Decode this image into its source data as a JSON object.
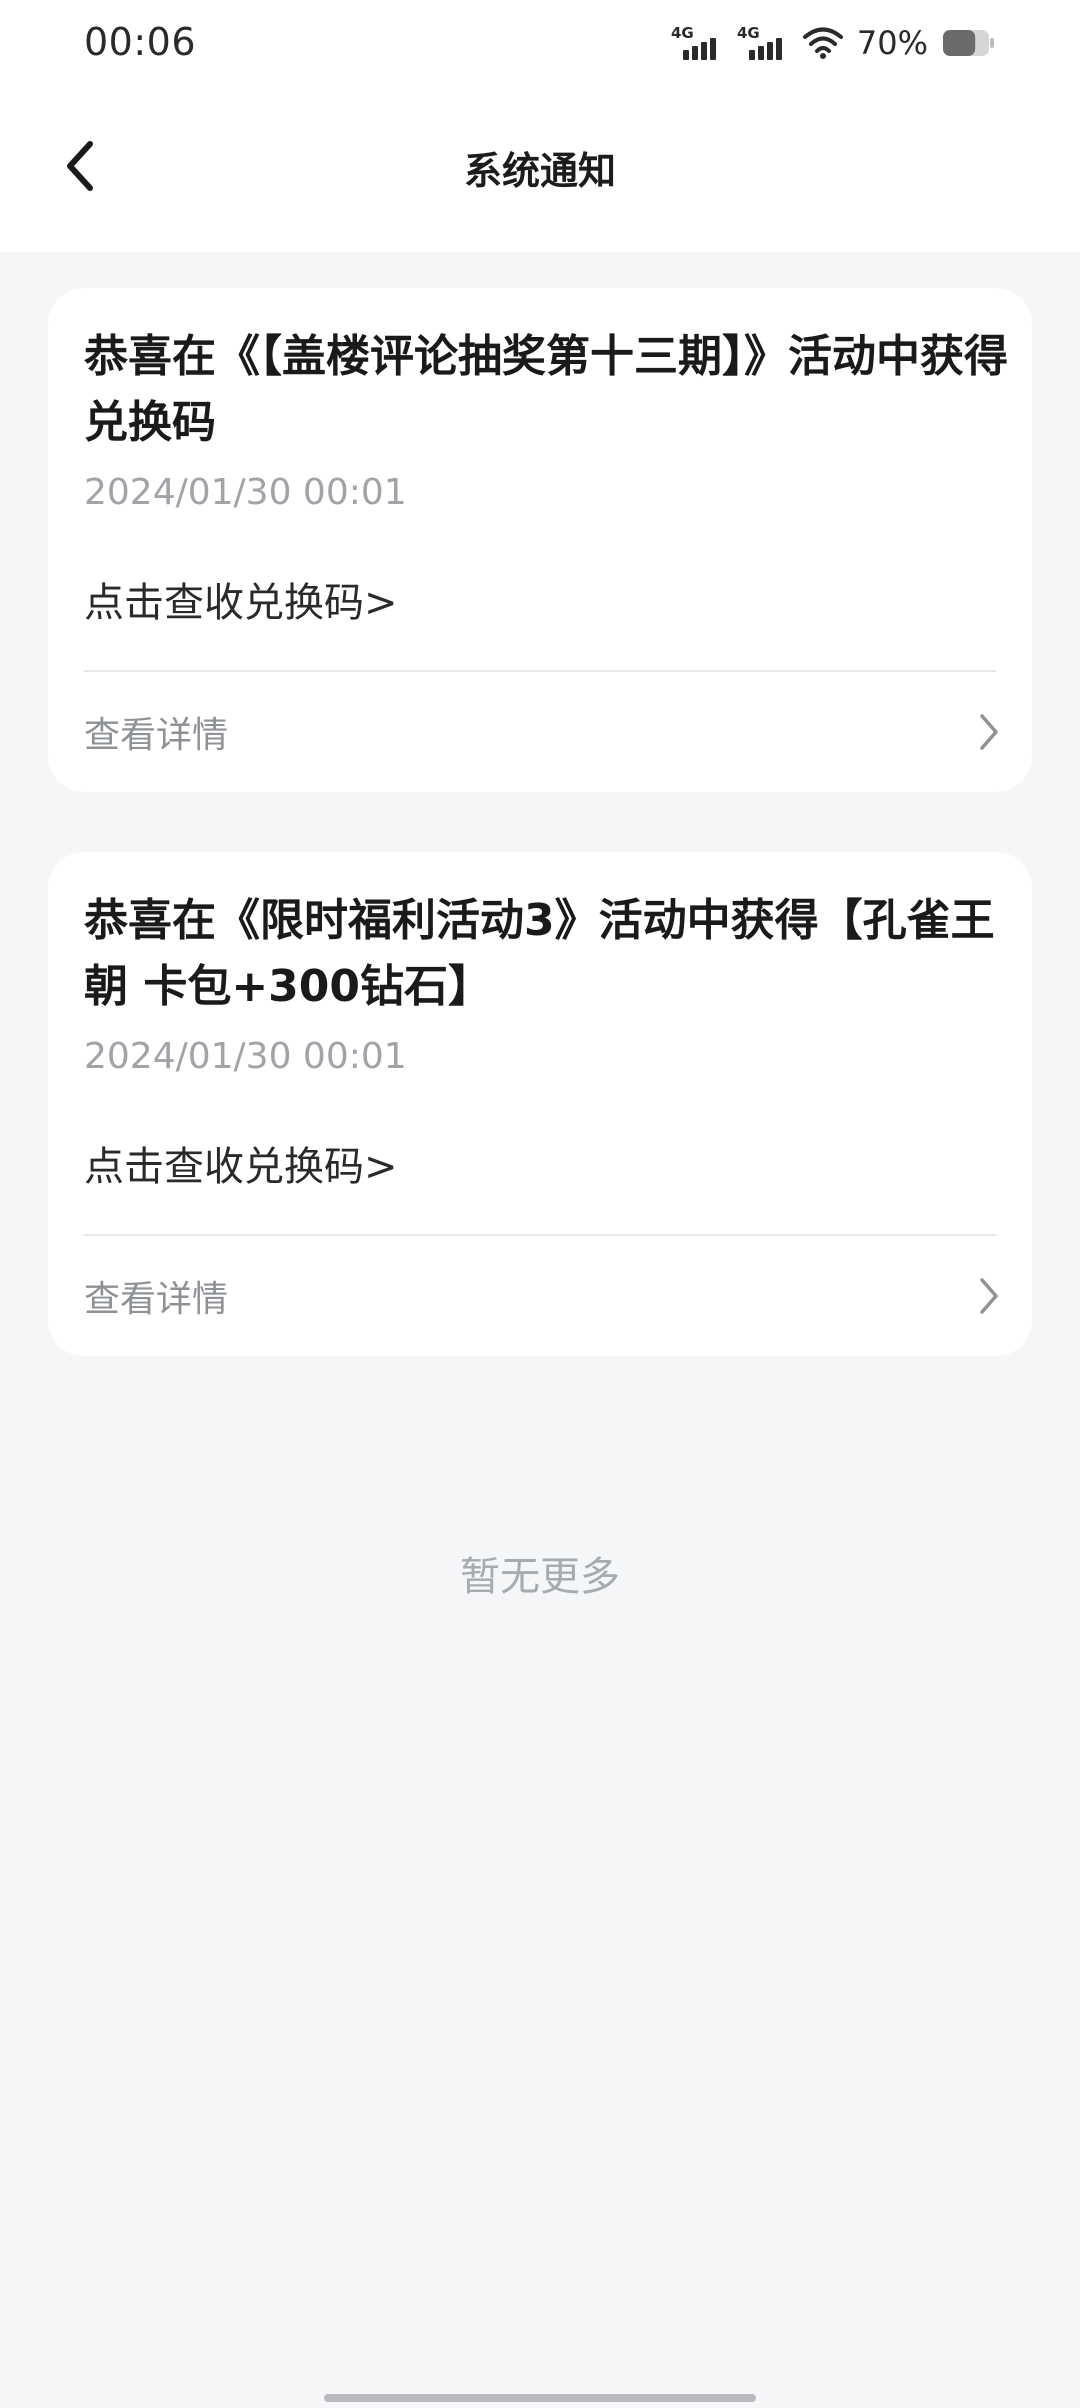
{
  "status_bar": {
    "time": "00:06",
    "network_1": "4G",
    "network_2": "4G",
    "battery_text": "70%",
    "battery_level": 0.7
  },
  "header": {
    "title": "系统通知"
  },
  "notifications": [
    {
      "title": "恭喜在《【盖楼评论抽奖第十三期】》活动中获得兑换码",
      "date": "2024/01/30 00:01",
      "link": "点击查收兑换码>",
      "footer": "查看详情"
    },
    {
      "title": "恭喜在《限时福利活动3》活动中获得【孔雀王朝 卡包+300钻石】",
      "date": "2024/01/30 00:01",
      "link": "点击查收兑换码>",
      "footer": "查看详情"
    }
  ],
  "footer_text": "暂无更多",
  "colors": {
    "background": "#f5f6f8",
    "card": "#ffffff",
    "muted_text": "#a0a3a8"
  }
}
